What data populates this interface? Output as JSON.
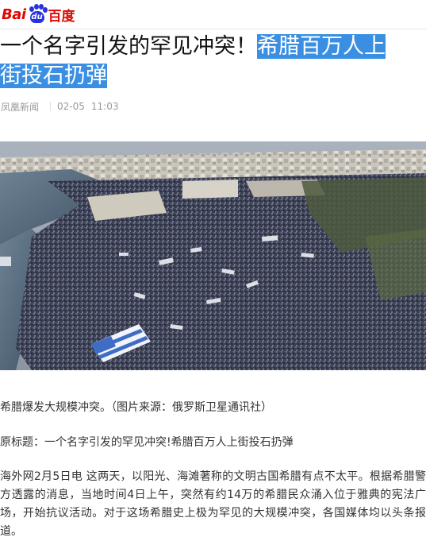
{
  "header": {
    "logo_part1": "Bai",
    "logo_mid": "du",
    "logo_part2": "百度"
  },
  "article": {
    "title_plain": "一个名字引发的罕见冲突！",
    "title_highlight_1": "希腊百万人上",
    "title_highlight_2": "街投石扔弹",
    "source": "凤凰新闻",
    "date": "02-05",
    "time": "11:03",
    "caption": "希腊爆发大规模冲突。（图片来源：俄罗斯卫星通讯社）",
    "original_title": "原标题：一个名字引发的罕见冲突!希腊百万人上街投石扔弹",
    "body": "海外网2月5日电 这两天，以阳光、海滩著称的文明古国希腊有点不太平。根据希腊警方透露的消息，当地时间4日上午，突然有约14万的希腊民众涌入位于雅典的宪法广场，开始抗议活动。对于这场希腊史上极为罕见的大规模冲突，各国媒体均以头条报道。"
  },
  "colors": {
    "highlight": "#3a8fe3",
    "brand_red": "#e10602",
    "brand_blue": "#2932e1",
    "meta": "#999999"
  }
}
